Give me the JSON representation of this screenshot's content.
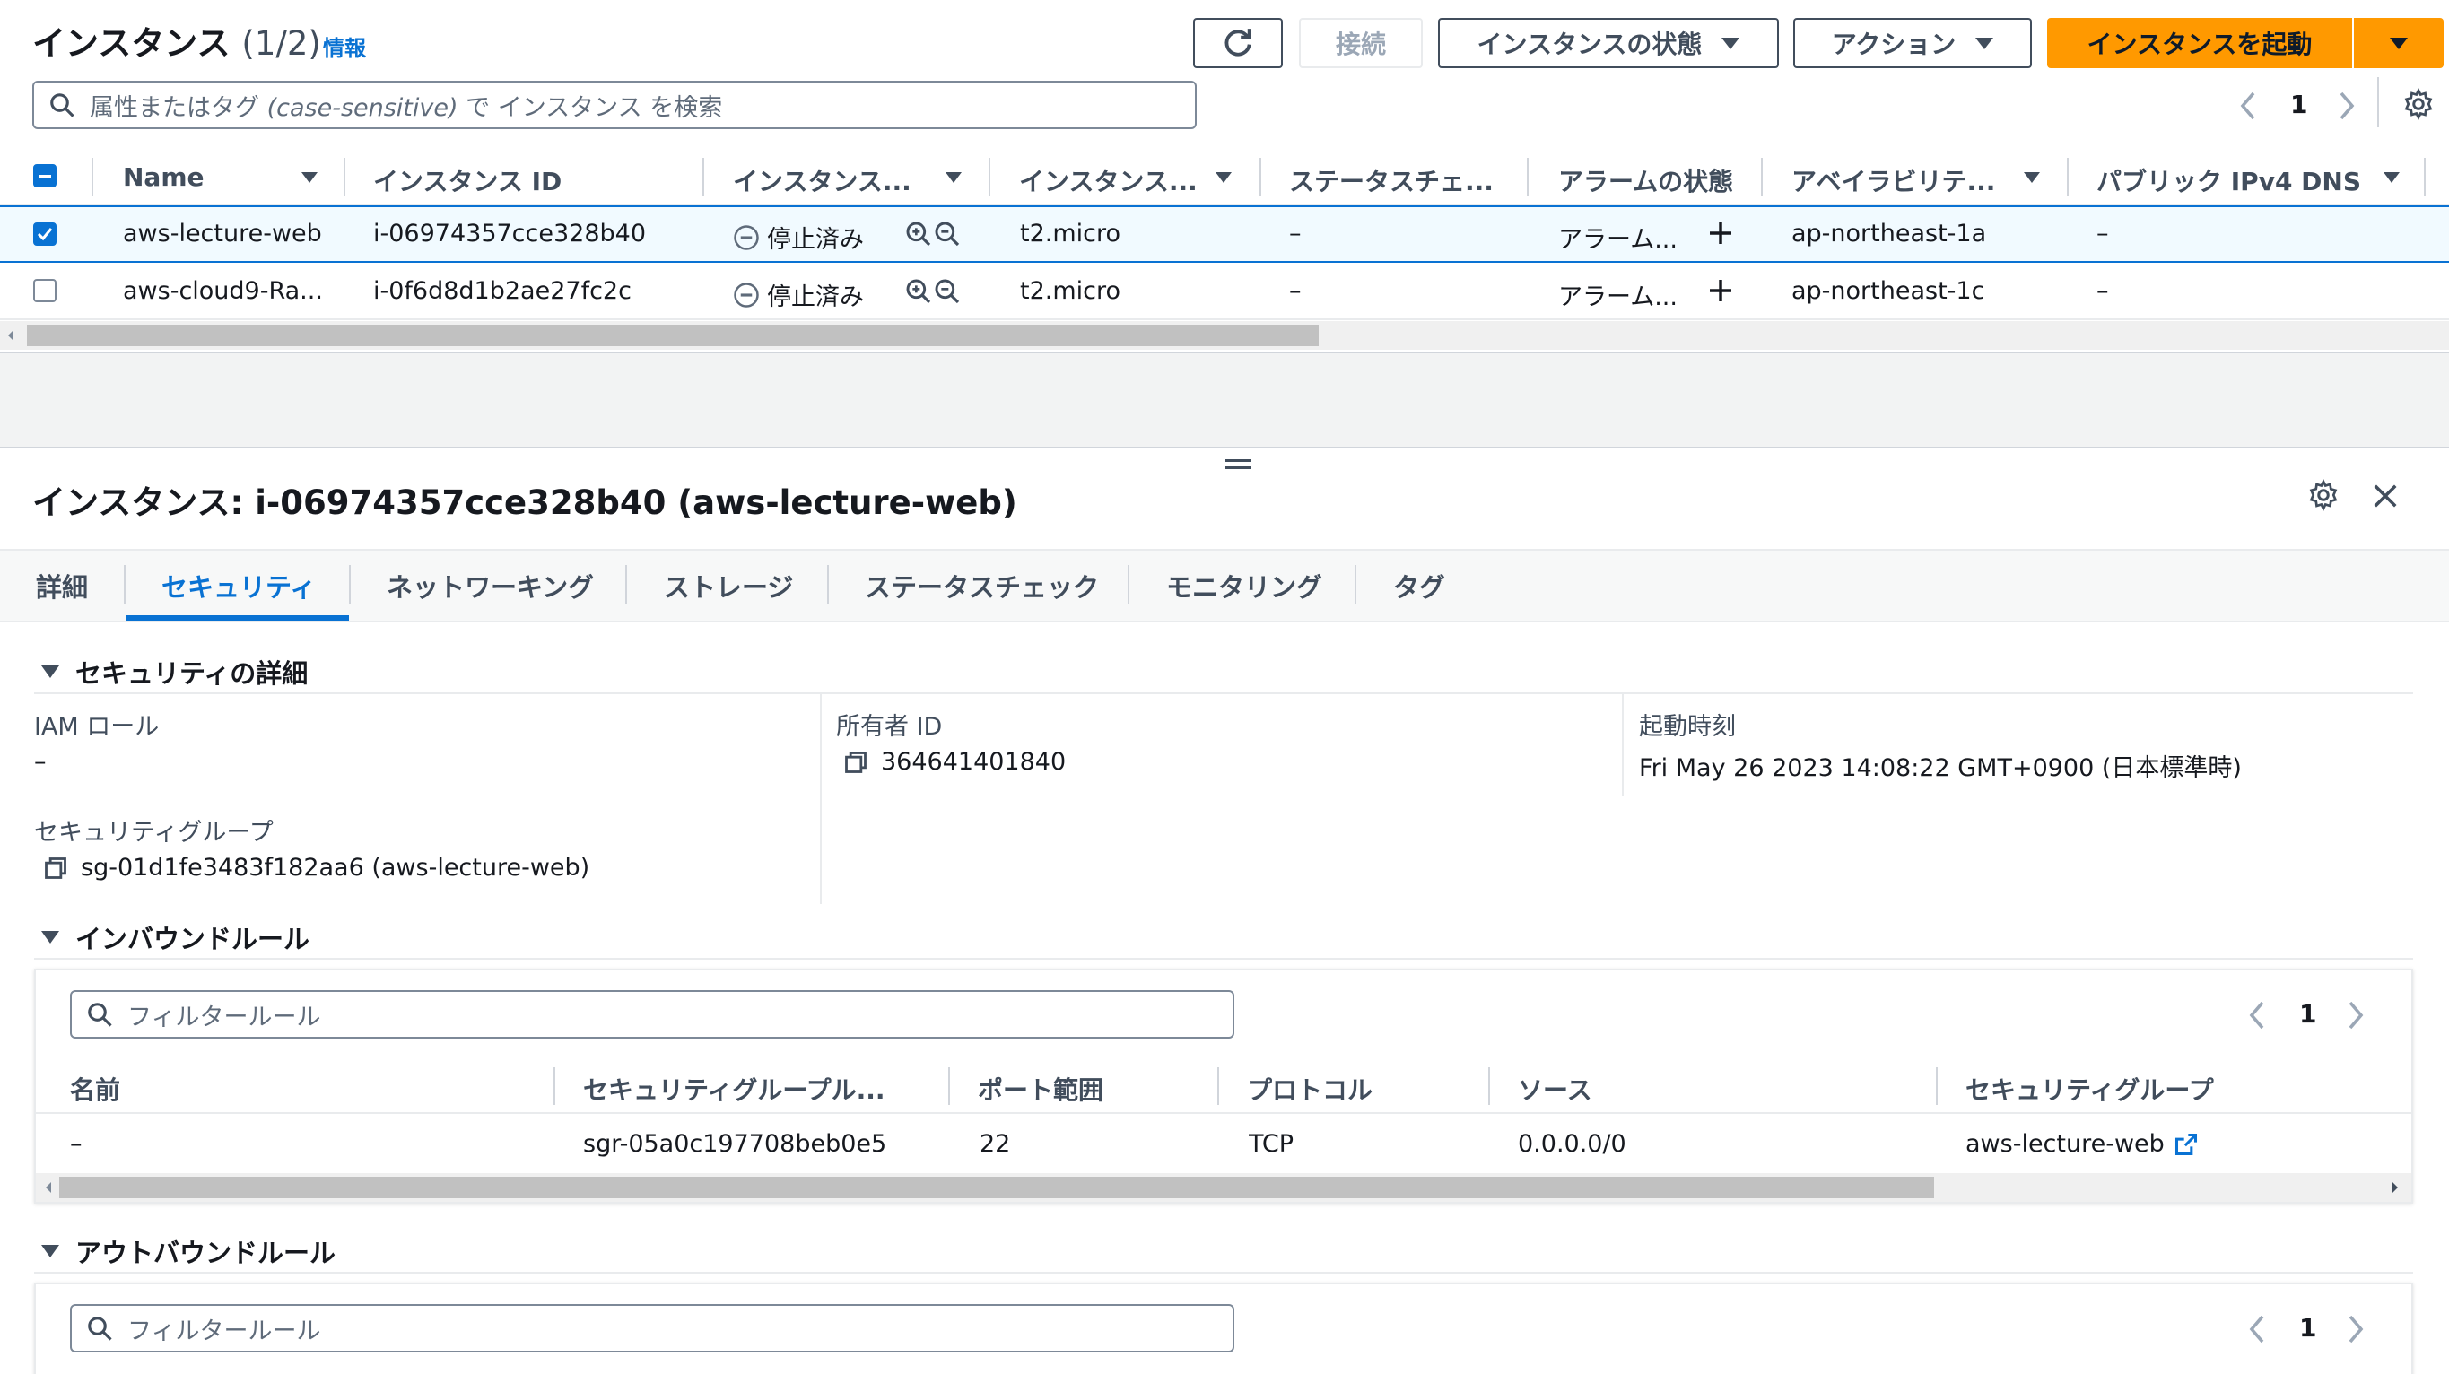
{
  "instances_panel": {
    "title": "インスタンス",
    "count": "(1/2)",
    "info_link": "情報",
    "buttons": {
      "refresh": "",
      "connect": "接続",
      "instance_state": "インスタンスの状態",
      "actions": "アクション",
      "launch": "インスタンスを起動"
    },
    "search": {
      "placeholder_part1": "属性またはタグ",
      "placeholder_part2": "(case-sensitive)",
      "placeholder_part3": "で インスタンス を検索"
    },
    "pagination": {
      "page": "1"
    },
    "columns": [
      "Name",
      "インスタンス ID",
      "インスタンス...",
      "インスタンス...",
      "ステータスチェ...",
      "アラームの状態",
      "アベイラビリテ...",
      "パブリック IPv4 DNS"
    ],
    "rows": [
      {
        "selected": true,
        "name": "aws-lecture-web",
        "id": "i-06974357cce328b40",
        "state": "停止済み",
        "type": "t2.micro",
        "status_check": "–",
        "alarm": "アラーム...",
        "az": "ap-northeast-1a",
        "dns": "–"
      },
      {
        "selected": false,
        "name": "aws-cloud9-Ra...",
        "id": "i-0f6d8d1b2ae27fc2c",
        "state": "停止済み",
        "type": "t2.micro",
        "status_check": "–",
        "alarm": "アラーム...",
        "az": "ap-northeast-1c",
        "dns": "–"
      }
    ]
  },
  "details_panel": {
    "title": "インスタンス: i-06974357cce328b40 (aws-lecture-web)",
    "tabs": [
      "詳細",
      "セキュリティ",
      "ネットワーキング",
      "ストレージ",
      "ステータスチェック",
      "モニタリング",
      "タグ"
    ],
    "active_tab": "セキュリティ",
    "security_details": {
      "heading": "セキュリティの詳細",
      "iam_role_label": "IAM ロール",
      "iam_role_value": "–",
      "owner_id_label": "所有者 ID",
      "owner_id_value": "364641401840",
      "launch_time_label": "起動時刻",
      "launch_time_value": "Fri May 26 2023 14:08:22 GMT+0900 (日本標準時)",
      "security_group_label": "セキュリティグループ",
      "security_group_value": "sg-01d1fe3483f182aa6 (aws-lecture-web)"
    },
    "inbound": {
      "heading": "インバウンドルール",
      "filter_placeholder": "フィルタールール",
      "page": "1",
      "columns": [
        "名前",
        "セキュリティグループル...",
        "ポート範囲",
        "プロトコル",
        "ソース",
        "セキュリティグループ"
      ],
      "rows": [
        {
          "name": "–",
          "rule_id": "sgr-05a0c197708beb0e5",
          "port": "22",
          "protocol": "TCP",
          "source": "0.0.0.0/0",
          "sg": "aws-lecture-web"
        }
      ]
    },
    "outbound": {
      "heading": "アウトバウンドルール",
      "filter_placeholder": "フィルタールール",
      "page": "1"
    }
  },
  "colors": {
    "link": "#0972d3",
    "primary_button": "#ff9900",
    "selected_row": "#f1faff",
    "border": "#e9ebed"
  }
}
